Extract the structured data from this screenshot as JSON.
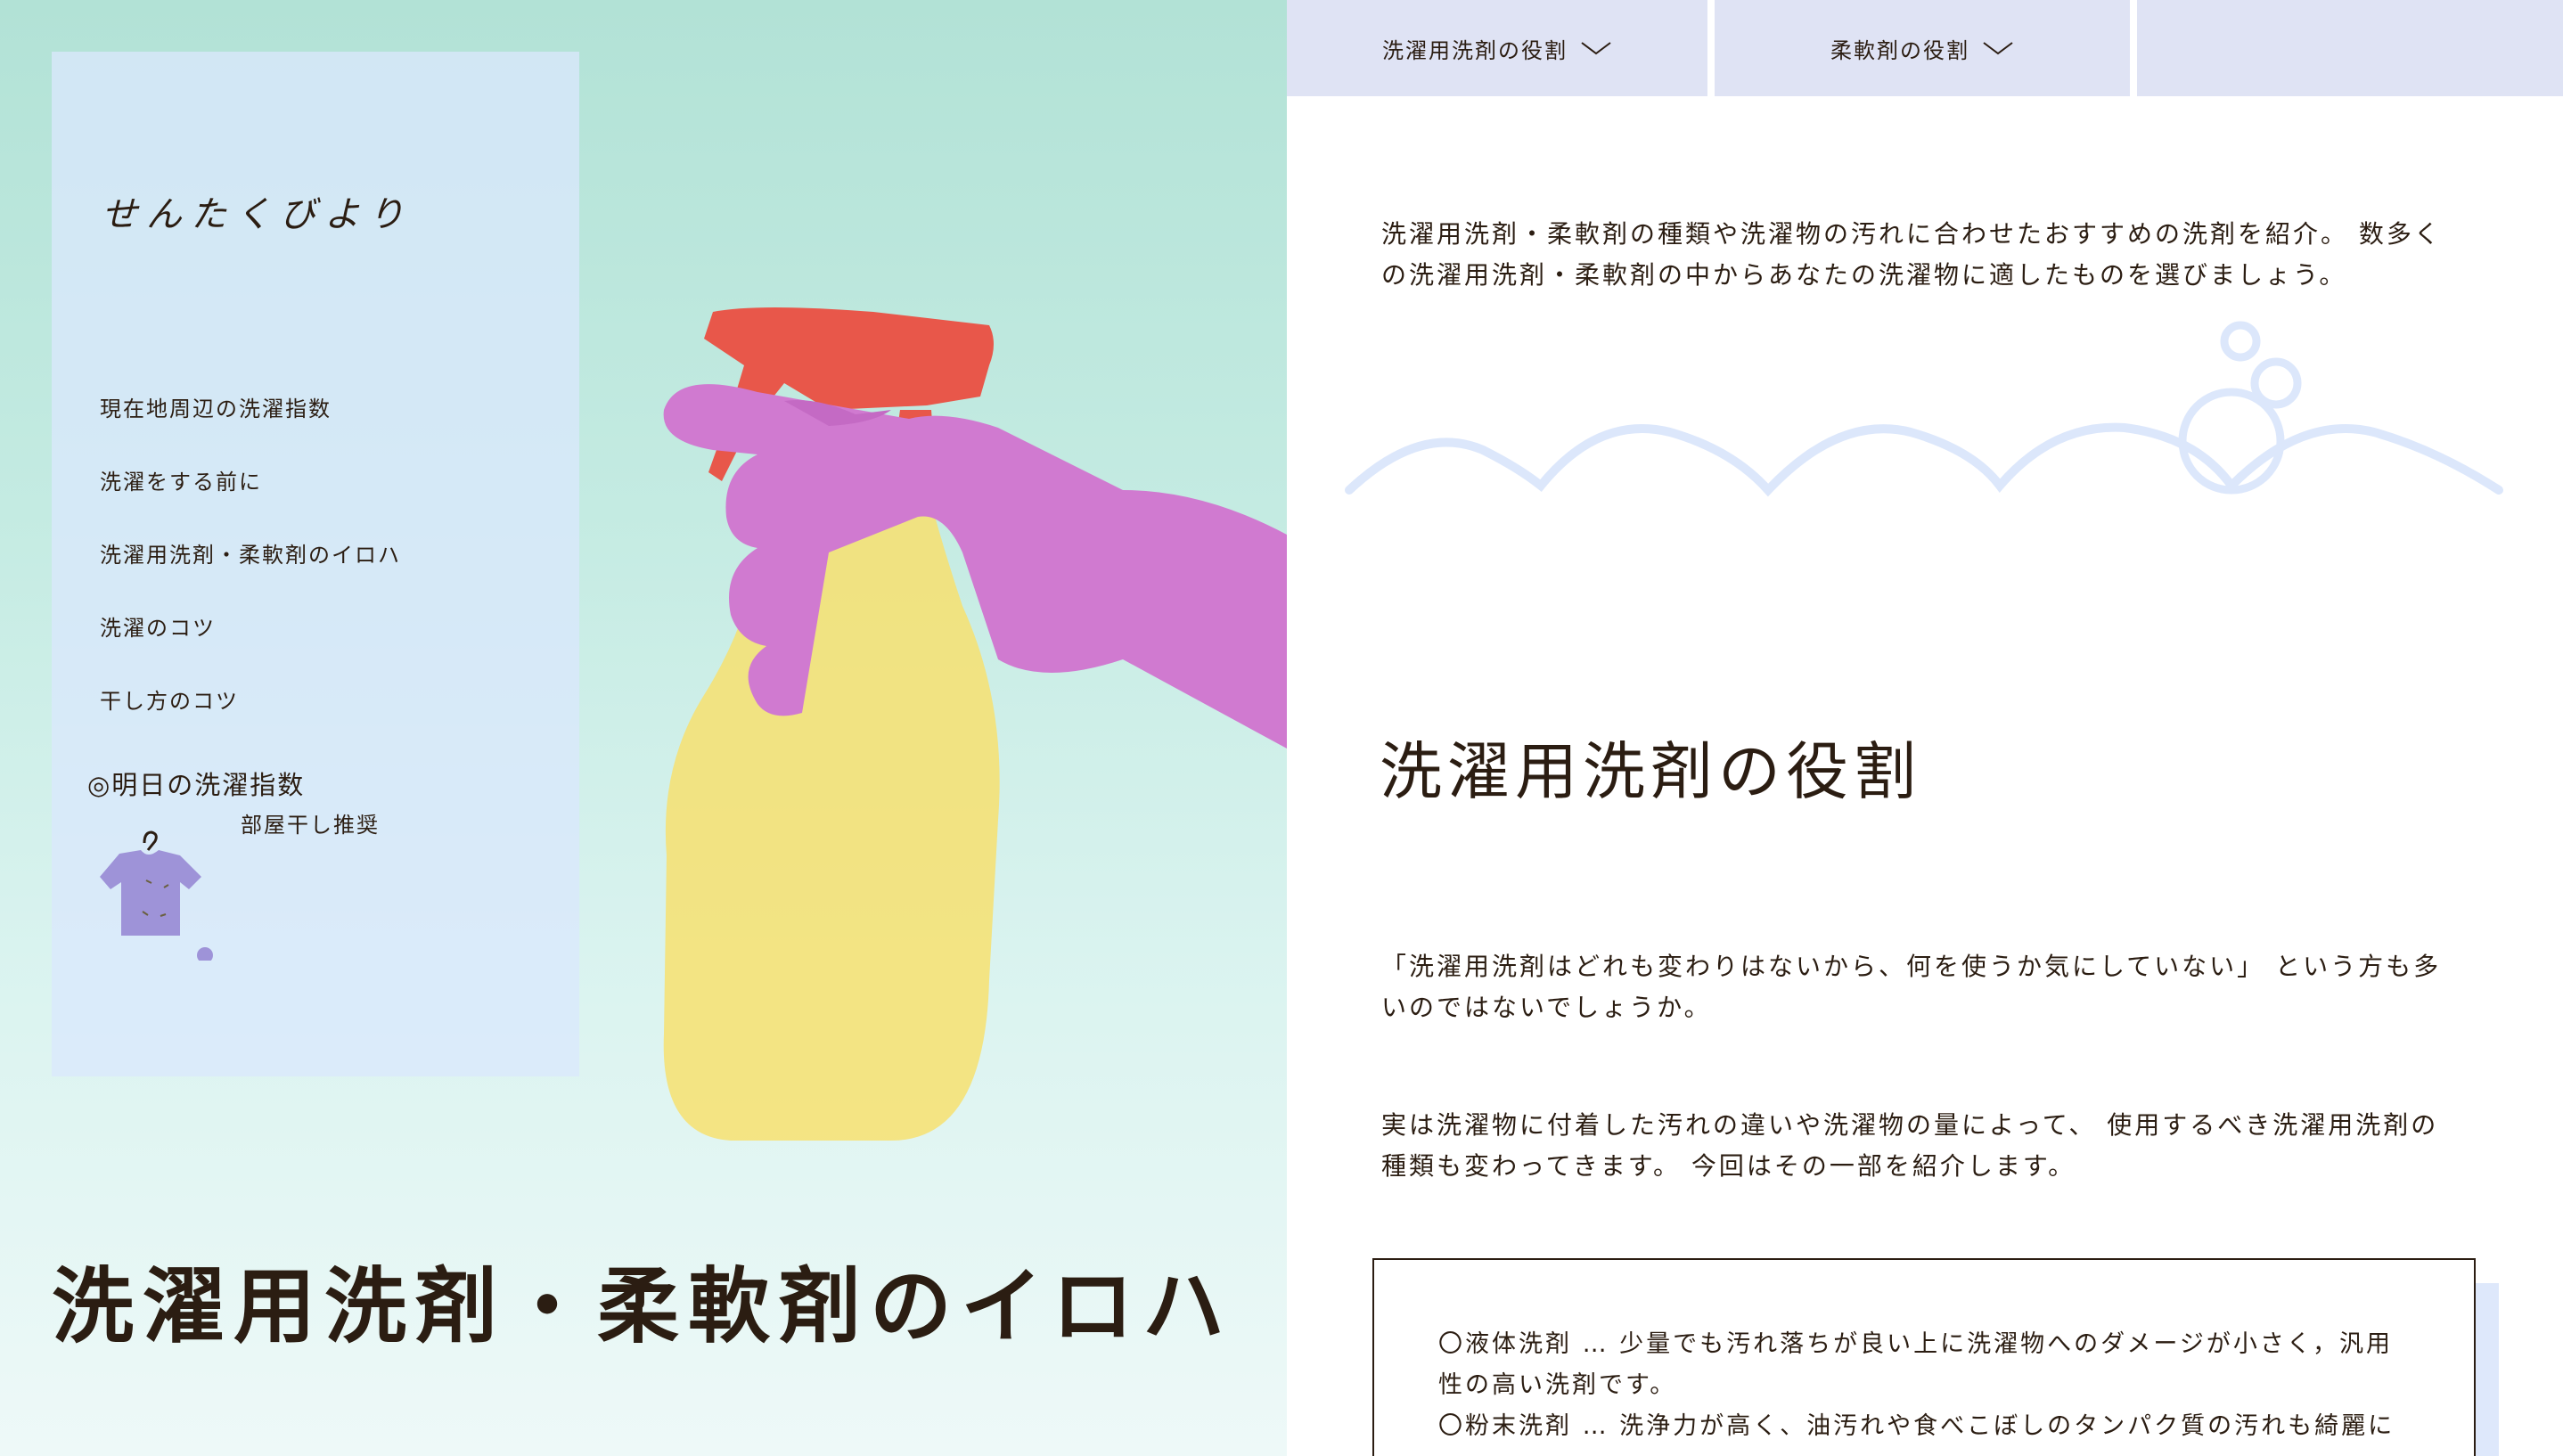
{
  "site": {
    "logo": "せんたくびより"
  },
  "sidebar": {
    "nav": [
      "現在地周辺の洗濯指数",
      "洗濯をする前に",
      "洗濯用洗剤・柔軟剤のイロハ",
      "洗濯のコツ",
      "干し方のコツ"
    ],
    "forecast_title": "◎明日の洗濯指数",
    "forecast_value": "部屋干し推奨"
  },
  "hero": {
    "title": "洗濯用洗剤・柔軟剤のイロハ"
  },
  "tabs": [
    {
      "label": "洗濯用洗剤の役割",
      "icon": "chevron-down-icon"
    },
    {
      "label": "柔軟剤の役割",
      "icon": "chevron-down-icon"
    },
    {
      "label": ""
    }
  ],
  "main": {
    "intro": "洗濯用洗剤・柔軟剤の種類や洗濯物の汚れに合わせたおすすめの洗剤を紹介。 数多くの洗濯用洗剤・柔軟剤の中からあなたの洗濯物に適したものを選びましょう。",
    "section_title": "洗濯用洗剤の役割",
    "para1": "「洗濯用洗剤はどれも変わりはないから、何を使うか気にしていない」 という方も多いのではないでしょうか。",
    "para2": "実は洗濯物に付着した汚れの違いや洗濯物の量によって、 使用するべき洗濯用洗剤の種類も変わってきます。 今回はその一部を紹介します。",
    "card_lines": [
      "〇液体洗剤 … 少量でも汚れ落ちが良い上に洗濯物へのダメージが小さく，汎用性の高い洗剤です。",
      "〇粉末洗剤 … 洗浄力が高く、油汚れや食べこぼしのタンパク質の汚れも綺麗に"
    ]
  },
  "colors": {
    "tab_bg": "#dfe3f4",
    "wave": "#dce7fb",
    "text": "#2b1d12",
    "glove": "#d07ad0",
    "bottle": "#f7e070",
    "nozzle": "#e8574a",
    "shirt": "#9e93d8"
  }
}
